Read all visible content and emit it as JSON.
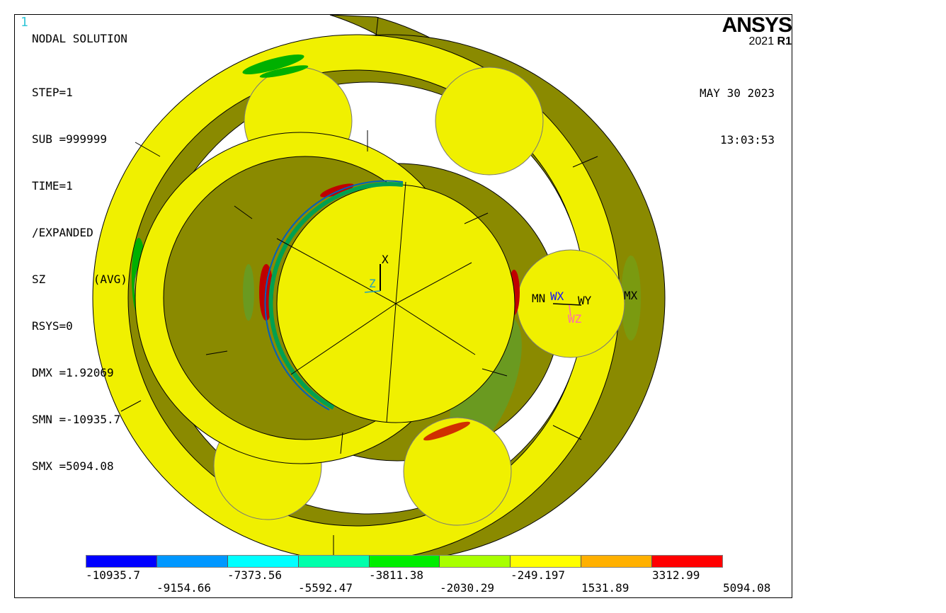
{
  "window_number": "1",
  "title": "NODAL SOLUTION",
  "stats": [
    "STEP=1",
    "SUB =999999",
    "TIME=1",
    "/EXPANDED",
    "SZ       (AVG)",
    "RSYS=0",
    "DMX =1.92069",
    "SMN =-10935.7",
    "SMX =5094.08"
  ],
  "brand": {
    "name": "ANSYS",
    "version": "2021",
    "release": "R1"
  },
  "date": "MAY 30 2023",
  "time": "13:03:53",
  "markers": {
    "min": "MN",
    "max": "MX",
    "wx": "WX",
    "wy": "WY",
    "wz": "WZ",
    "x": "X",
    "z": "Z"
  },
  "legend": {
    "colors": [
      "#0000ff",
      "#0097ff",
      "#00ffff",
      "#00ffab",
      "#00ee00",
      "#a8ff00",
      "#ffff00",
      "#ffb000",
      "#ff0000"
    ],
    "labels_top": [
      "-10935.7",
      "-7373.56",
      "-3811.38",
      "-249.197",
      "3312.99"
    ],
    "labels_bottom": [
      "-9154.66",
      "-5592.47",
      "-2030.29",
      "1531.89",
      "5094.08"
    ]
  }
}
